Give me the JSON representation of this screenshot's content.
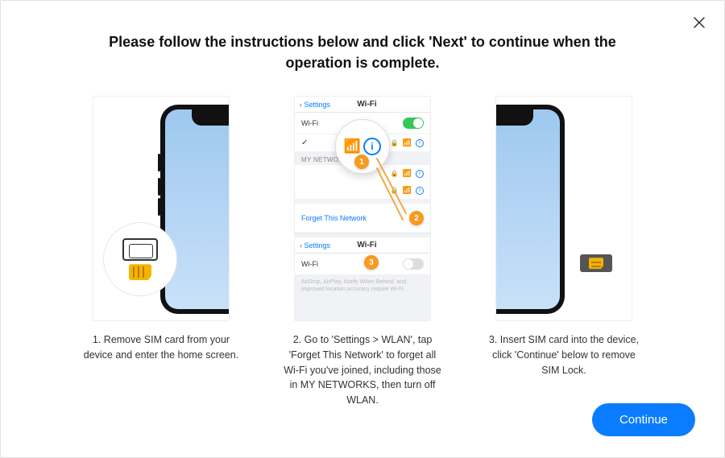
{
  "heading": "Please follow the instructions below and click 'Next' to continue when the operation is complete.",
  "close_label": "Close",
  "steps": {
    "s1": {
      "caption": "1. Remove SIM card from your device and enter the home screen."
    },
    "s2": {
      "caption": "2. Go to 'Settings > WLAN', tap 'Forget This Network' to forget all Wi-Fi you've joined, including those in MY NETWORKS, then turn off WLAN.",
      "back": "Settings",
      "title": "Wi-Fi",
      "row_wifi": "Wi-Fi",
      "section_my": "MY NETWORKS",
      "forget": "Forget This Network",
      "fine_print": "AirDrop, AirPlay, Notify When Behind, and improved location accuracy require Wi-Fi.",
      "badges": {
        "b1": "1",
        "b2": "2",
        "b3": "3"
      }
    },
    "s3": {
      "caption": "3. Insert SIM card  into the device, click 'Continue' below to remove SIM Lock."
    }
  },
  "continue_label": "Continue"
}
